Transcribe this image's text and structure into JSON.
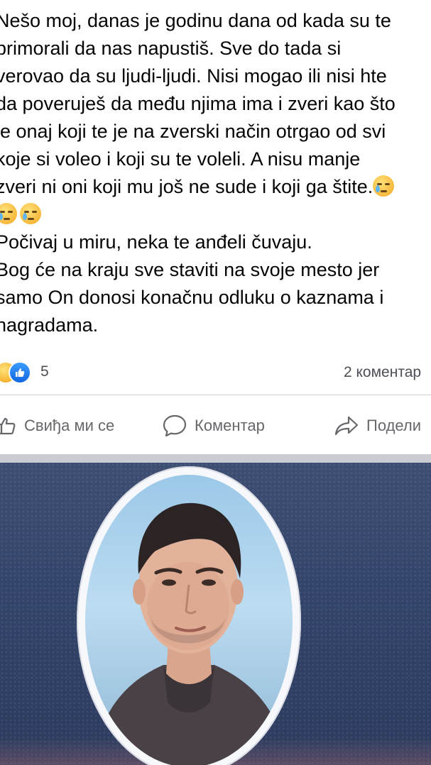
{
  "post": {
    "lines": [
      "Nešo moj, danas je godinu dana od kada su te",
      "primorali da nas napustiš. Sve do tada si",
      "verovao da su ljudi-ljudi. Nisi mogao ili nisi hte",
      "da poveruješ da među njima ima i zveri kao što",
      "je onaj koji te je na zverski način otrgao od svi",
      "koje si voleo i koji su te voleli. A nisu manje",
      "zveri ni oni koji mu još ne sude i koji ga štite."
    ],
    "emoji_line_icons": [
      "crying-face-icon",
      "crying-face-icon"
    ],
    "trailing_emoji_icon": "crying-face-icon",
    "lines_after": [
      "Počivaj u miru, neka te anđeli čuvaju.",
      "Bog će na kraju sve staviti na svoje mesto jer",
      "samo On donosi konačnu odluku o kaznama i",
      "nagradama."
    ]
  },
  "reactions": {
    "icons": [
      "sad-reaction-icon",
      "like-reaction-icon"
    ],
    "count": "5",
    "comments": "2 коментар"
  },
  "actions": {
    "like": "Свиђа ми се",
    "comment": "Коментар",
    "share": "Подели"
  },
  "photo": {
    "description_icon": "memorial-portrait-image"
  },
  "colors": {
    "text": "#050505",
    "meta": "#65676b",
    "like_blue": "#1877f2",
    "divider": "#ced0d4"
  }
}
